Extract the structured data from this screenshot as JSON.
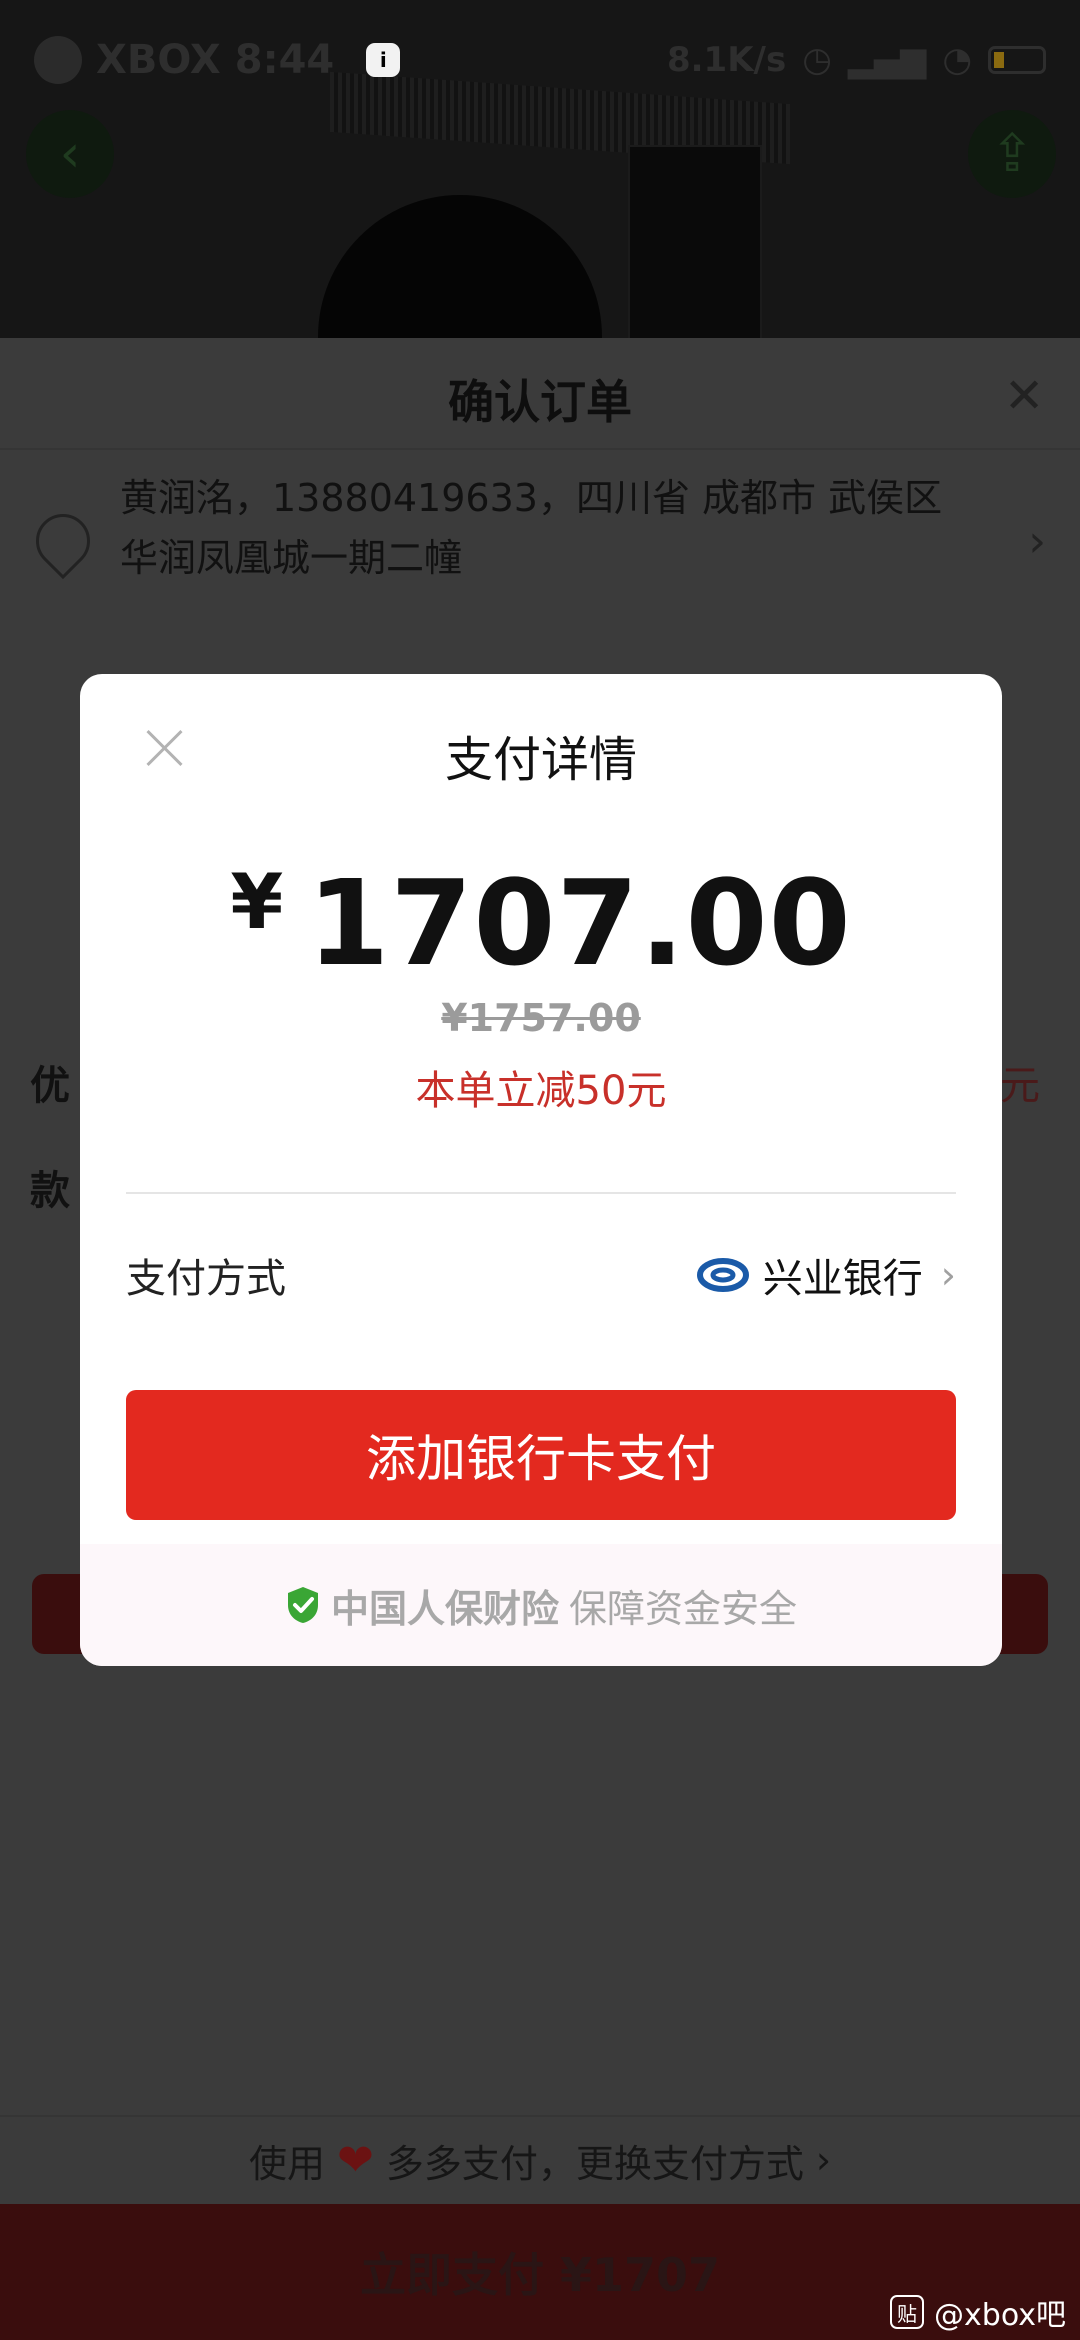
{
  "status_bar": {
    "carrier": "XBOX",
    "time": "8:44",
    "speed": "8.1K/s",
    "battery": "21"
  },
  "order_sheet": {
    "title": "确认订单",
    "address_line1": "黄润洺，13880419633，四川省 成都市 武侯区",
    "address_line2": "华润凤凰城一期二幢",
    "partial_label_1": "优",
    "partial_label_2": "款",
    "partial_right": "元"
  },
  "modal": {
    "title": "支付详情",
    "currency_symbol": "¥",
    "amount": "1707.00",
    "original_price": "¥1757.00",
    "discount_text": "本单立减50元",
    "method_label": "支付方式",
    "bank_name": "兴业银行",
    "add_card_button": "添加银行卡支付",
    "insurance_brand": "中国人保财险",
    "insurance_text": "保障资金安全"
  },
  "footer": {
    "switch_prefix": "使用",
    "switch_suffix": "多多支付，更换支付方式",
    "pay_button": "立即支付 ¥1707",
    "watermark": "@xbox吧"
  },
  "colors": {
    "accent_red": "#e3291f",
    "discount_red": "#c8302a",
    "bank_blue": "#1a5aa8",
    "shield_green": "#3aa635"
  },
  "icons": [
    "back-arrow-icon",
    "share-icon",
    "close-icon",
    "location-pin-icon",
    "chevron-right-icon",
    "bank-logo-icon",
    "shield-check-icon",
    "heart-icon"
  ]
}
